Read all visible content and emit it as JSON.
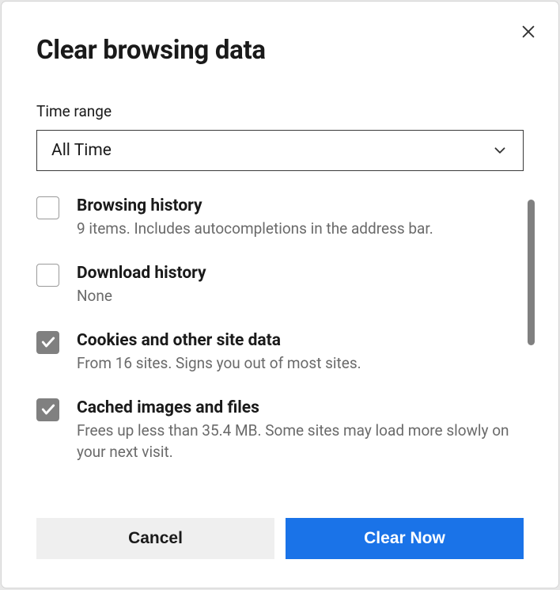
{
  "dialog": {
    "title": "Clear browsing data",
    "time_range_label": "Time range",
    "time_range_value": "All Time",
    "items": [
      {
        "title": "Browsing history",
        "desc": "9 items. Includes autocompletions in the address bar.",
        "checked": false
      },
      {
        "title": "Download history",
        "desc": "None",
        "checked": false
      },
      {
        "title": "Cookies and other site data",
        "desc": "From 16 sites. Signs you out of most sites.",
        "checked": true
      },
      {
        "title": "Cached images and files",
        "desc": "Frees up less than 35.4 MB. Some sites may load more slowly on your next visit.",
        "checked": true
      }
    ],
    "cancel_label": "Cancel",
    "clear_label": "Clear Now"
  }
}
